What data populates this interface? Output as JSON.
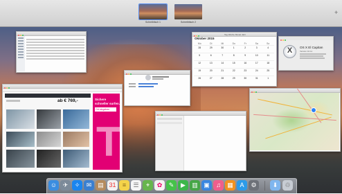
{
  "spaces": {
    "items": [
      {
        "label": "Schreibtisch 1"
      },
      {
        "label": "Schreibtisch 2"
      }
    ],
    "add_label": "+"
  },
  "calendar": {
    "month_title": "Oktober 2015",
    "view_buttons": [
      "Tag",
      "Woche",
      "Monat",
      "Jahr"
    ],
    "weekdays": [
      "Mo",
      "Di",
      "Mi",
      "Do",
      "Fr",
      "Sa",
      "So"
    ],
    "weeks": [
      [
        "28",
        "29",
        "30",
        "1",
        "2",
        "3",
        "4"
      ],
      [
        "5",
        "6",
        "7",
        "8",
        "9",
        "10",
        "11"
      ],
      [
        "12",
        "13",
        "14",
        "15",
        "16",
        "17",
        "18"
      ],
      [
        "19",
        "20",
        "21",
        "22",
        "23",
        "24",
        "25"
      ],
      [
        "26",
        "27",
        "28",
        "29",
        "30",
        "31",
        "1"
      ],
      [
        "2",
        "3",
        "4",
        "5",
        "6",
        "7",
        "8"
      ]
    ]
  },
  "about_mac": {
    "logo_glyph": "X",
    "os_name": "OS X El Capitan",
    "version": "Version 10.11"
  },
  "browser": {
    "price": "ab € 769,-",
    "ad_line1": "Sichere",
    "ad_line2": "schneller surfen.",
    "ad_cta": "Ort eingeben",
    "ad_brand": "T"
  },
  "dock": {
    "icons": [
      {
        "name": "finder-icon",
        "glyph": "☺",
        "color": "#3b8de0"
      },
      {
        "name": "launchpad-icon",
        "glyph": "✈",
        "color": "#7c8a99"
      },
      {
        "name": "safari-icon",
        "glyph": "✧",
        "color": "#1a85ef"
      },
      {
        "name": "mail-icon",
        "glyph": "✉",
        "color": "#3a7fd0"
      },
      {
        "name": "contacts-icon",
        "glyph": "▤",
        "color": "#b58b5d"
      },
      {
        "name": "calendar-icon",
        "glyph": "31",
        "color": "#f2f2f2"
      },
      {
        "name": "notes-icon",
        "glyph": "≡",
        "color": "#f4d34a"
      },
      {
        "name": "reminders-icon",
        "glyph": "☰",
        "color": "#f6f6f6"
      },
      {
        "name": "maps-icon",
        "glyph": "⌖",
        "color": "#67b54d"
      },
      {
        "name": "photos-icon",
        "glyph": "✿",
        "color": "#f3f3f3"
      },
      {
        "name": "messages-icon",
        "glyph": "✎",
        "color": "#45c24a"
      },
      {
        "name": "facetime-icon",
        "glyph": "▶",
        "color": "#3cb64b"
      },
      {
        "name": "numbers-icon",
        "glyph": "▥",
        "color": "#46a647"
      },
      {
        "name": "keynote-icon",
        "glyph": "▣",
        "color": "#3a86e0"
      },
      {
        "name": "itunes-icon",
        "glyph": "♫",
        "color": "#f05e8c"
      },
      {
        "name": "ibooks-icon",
        "glyph": "▦",
        "color": "#f2921e"
      },
      {
        "name": "appstore-icon",
        "glyph": "A",
        "color": "#2c9be8"
      },
      {
        "name": "system-preferences-icon",
        "glyph": "⚙",
        "color": "#6d7178"
      },
      {
        "name": "downloads-folder-icon",
        "glyph": "⬇",
        "color": "#7fb6ee"
      },
      {
        "name": "trash-icon",
        "glyph": "♲",
        "color": "#c7ccd3"
      }
    ]
  },
  "colors": {
    "accent": "#5a8ff0",
    "telekom_magenta": "#e20074"
  }
}
